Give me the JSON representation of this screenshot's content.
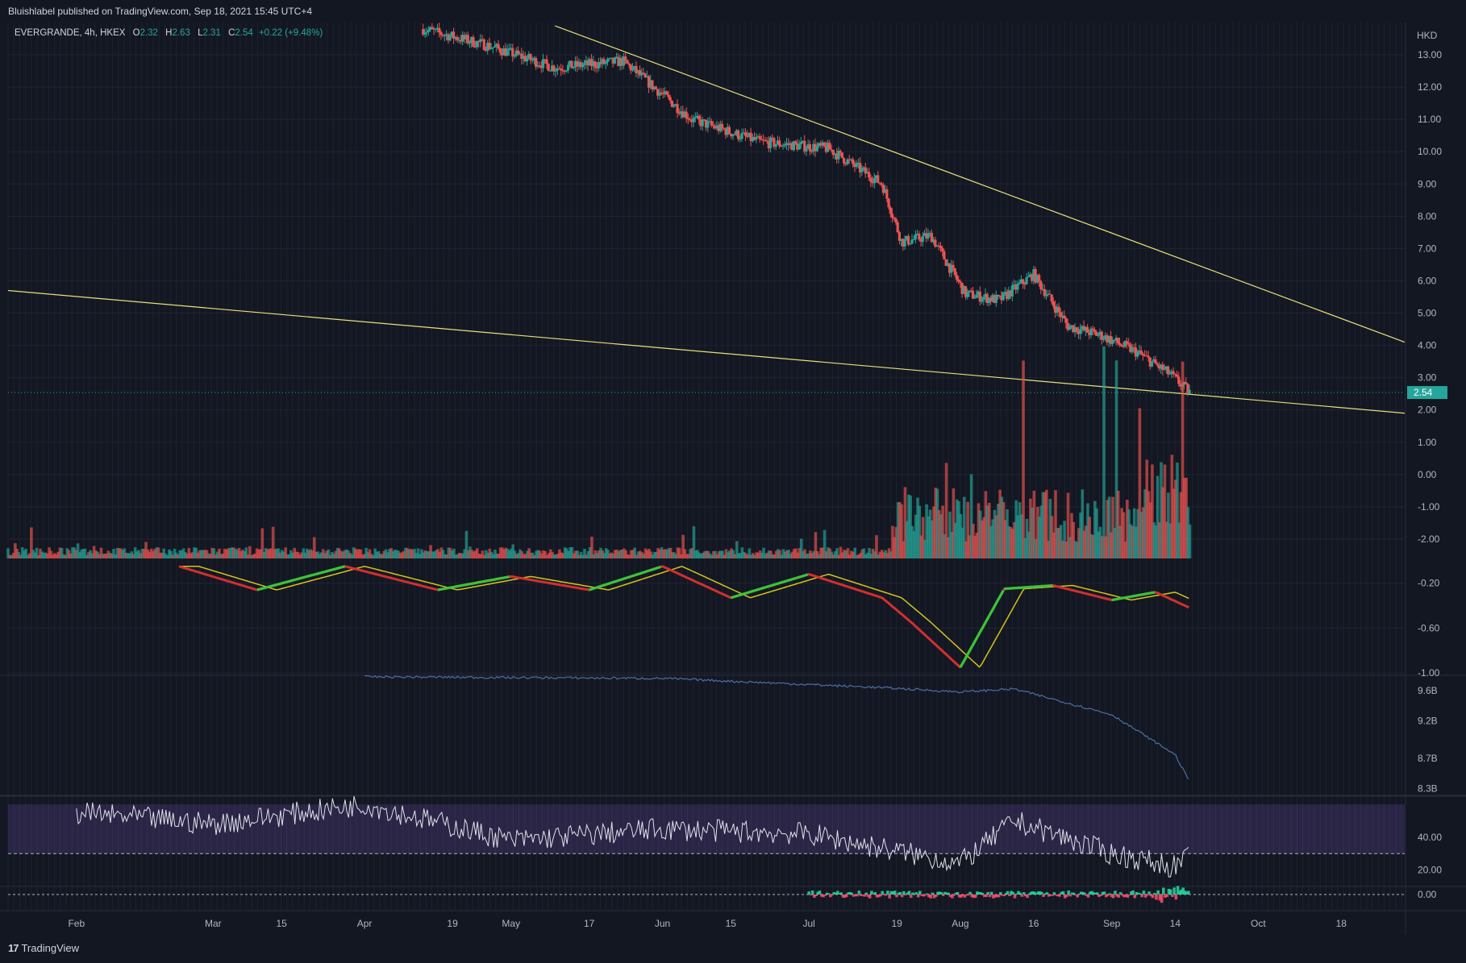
{
  "header": {
    "published": "Bluishlabel published on TradingView.com, Sep 18, 2021 15:45 UTC+4"
  },
  "legend": {
    "symbol": "EVERGRANDE, 4h, HKEX",
    "o_label": "O",
    "o_value": "2.32",
    "h_label": "H",
    "h_value": "2.63",
    "l_label": "L",
    "l_value": "2.31",
    "c_label": "C",
    "c_value": "2.54",
    "change": "+0.22 (+9.48%)"
  },
  "footer": {
    "brand": "TradingView",
    "brand_mark": "17"
  },
  "colors": {
    "background": "#131722",
    "up": "#26a69a",
    "down": "#ef5350",
    "trendline": "#e8e07a",
    "obv": "#4a6fa5",
    "rsi_band": "#7e57c2"
  },
  "chart_data": [
    {
      "type": "candlestick",
      "pane": "price",
      "currency": "HKD",
      "last_price": "2.54",
      "y_ticks": [
        "13.00",
        "12.00",
        "11.00",
        "10.00",
        "9.00",
        "8.00",
        "7.00",
        "6.00",
        "5.00",
        "4.00",
        "3.00",
        "2.00",
        "1.00",
        "0.00",
        "-1.00",
        "-2.00"
      ],
      "x_ticks": [
        "Feb",
        "Mar",
        "15",
        "Apr",
        "19",
        "May",
        "17",
        "Jun",
        "15",
        "Jul",
        "19",
        "Aug",
        "16",
        "Sep",
        "14",
        "Oct",
        "18"
      ],
      "ylim": [
        -2.6,
        14.0
      ],
      "x": [
        "Apr 13",
        "Apr 26",
        "May 10",
        "May 24",
        "Jun 7",
        "Jun 21",
        "Jul 5",
        "Jul 16",
        "Jul 20",
        "Jul 26",
        "Aug 2",
        "Aug 9",
        "Aug 16",
        "Aug 23",
        "Aug 30",
        "Sep 6",
        "Sep 13",
        "Sep 17"
      ],
      "close": [
        13.8,
        13.3,
        12.6,
        12.8,
        11.0,
        10.3,
        10.1,
        9.0,
        7.2,
        7.4,
        5.6,
        5.4,
        6.2,
        4.6,
        4.3,
        3.8,
        3.1,
        2.54
      ],
      "trendlines": [
        {
          "from": [
            "May 10",
            13.9
          ],
          "to": [
            "Oct 31",
            4.1
          ]
        },
        {
          "from": [
            "Jan 18",
            5.7
          ],
          "to": [
            "Oct 31",
            1.9
          ]
        }
      ]
    },
    {
      "type": "bar",
      "pane": "volume",
      "note_values": "relative heights only"
    },
    {
      "type": "line",
      "pane": "oscillator",
      "y_ticks": [
        "-0.20",
        "-0.60",
        "-1.00"
      ],
      "ylim": [
        -1.02,
        0.02
      ],
      "x": [
        "Feb 22",
        "Mar 10",
        "Mar 28",
        "Apr 16",
        "May 1",
        "May 17",
        "Jun 1",
        "Jun 15",
        "Jul 1",
        "Jul 16",
        "Jul 22",
        "Aug 1",
        "Aug 10",
        "Aug 20",
        "Sep 1",
        "Sep 10",
        "Sep 17"
      ],
      "values": [
        -0.05,
        -0.26,
        -0.05,
        -0.26,
        -0.14,
        -0.26,
        -0.05,
        -0.33,
        -0.12,
        -0.33,
        -0.55,
        -0.95,
        -0.25,
        -0.22,
        -0.35,
        -0.28,
        -0.42
      ]
    },
    {
      "type": "line",
      "pane": "obv",
      "y_ticks": [
        "9.6B",
        "9.2B",
        "8.7B",
        "8.3B"
      ],
      "ylim": [
        8.2,
        9.8
      ],
      "x": [
        "Apr 1",
        "Jun 1",
        "Jul 15",
        "Aug 1",
        "Aug 12",
        "Sep 1",
        "Sep 14",
        "Sep 17"
      ],
      "values": [
        9.78,
        9.76,
        9.64,
        9.58,
        9.62,
        9.28,
        8.75,
        8.38
      ]
    },
    {
      "type": "line",
      "pane": "rsi",
      "y_ticks": [
        "40.00",
        "20.00"
      ],
      "ylim": [
        10,
        65
      ],
      "band": [
        30,
        60
      ],
      "x": [
        "Feb 1",
        "Mar 1",
        "Apr 1",
        "May 1",
        "Jun 1",
        "Jul 1",
        "Aug 1",
        "Aug 12",
        "Sep 1",
        "Sep 14",
        "Sep 17"
      ],
      "values": [
        55,
        48,
        60,
        38,
        45,
        42,
        24,
        50,
        30,
        22,
        28
      ]
    },
    {
      "type": "area",
      "pane": "histogram",
      "y_ticks": [
        "0.00"
      ]
    }
  ]
}
